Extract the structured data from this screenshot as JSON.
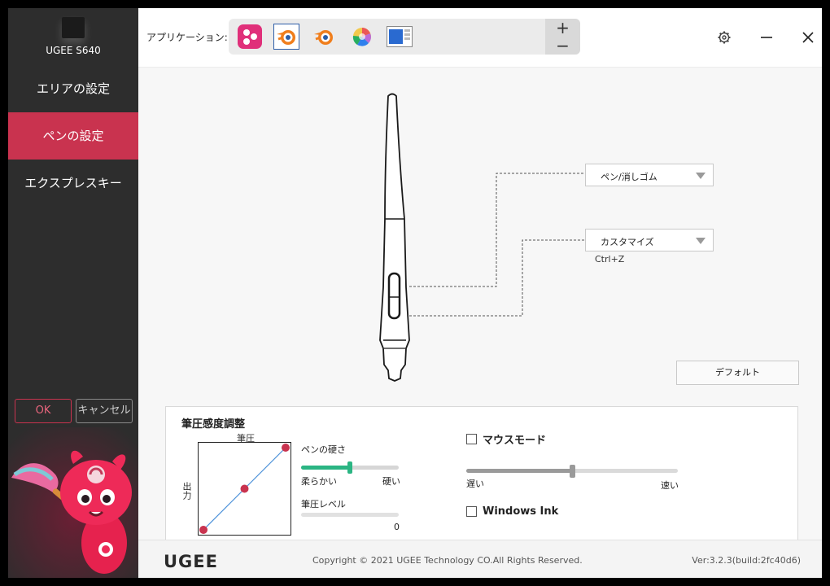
{
  "sidebar": {
    "device_name": "UGEE S640",
    "nav": [
      {
        "label": "エリアの設定"
      },
      {
        "label": "ペンの設定",
        "active": true
      },
      {
        "label": "エクスプレスキー"
      }
    ],
    "ok_label": "OK",
    "cancel_label": "キャンセル"
  },
  "header": {
    "app_label": "アプリケーション:",
    "apps": [
      {
        "icon": "app-launcher-icon",
        "color": "#e0307a"
      },
      {
        "icon": "blender-icon",
        "color": "#f07e1c",
        "selected": true
      },
      {
        "icon": "blender-icon",
        "color": "#f07e1c"
      },
      {
        "icon": "color-wheel-icon"
      },
      {
        "icon": "window-app-icon",
        "color": "#2a6ad0"
      }
    ],
    "plus": "+",
    "minus": "−",
    "settings_icon": "gear-icon",
    "minimize_icon": "minimize-icon",
    "close_icon": "close-icon"
  },
  "pen": {
    "upper_button": {
      "value": "ペン/消しゴム"
    },
    "lower_button": {
      "value": "カスタマイズ",
      "shortcut": "Ctrl+Z"
    },
    "default_label": "デフォルト"
  },
  "pressure": {
    "title": "筆圧感度調整",
    "graph_top_label": "筆圧",
    "graph_side_label": "出力",
    "curve_points": [
      [
        0,
        0
      ],
      [
        0.5,
        0.5
      ],
      [
        1,
        1
      ]
    ],
    "hardness_label": "ペンの硬さ",
    "hardness_value": 0.5,
    "soft_label": "柔らかい",
    "hard_label": "硬い",
    "level_label": "筆圧レベル",
    "level_value": "0",
    "mouse_mode_label": "マウスモード",
    "mouse_mode_checked": false,
    "speed_value": 0.5,
    "slow_label": "遅い",
    "fast_label": "速い",
    "windows_ink_label": "Windows Ink",
    "windows_ink_checked": false
  },
  "footer": {
    "logo": "UGEE",
    "copyright": "Copyright © 2021 UGEE Technology CO.All Rights Reserved.",
    "version": "Ver:3.2.3(build:2fc40d6)"
  },
  "colors": {
    "accent": "#c9334f",
    "slider_green": "#2bb583",
    "curve_line": "#4a90d9",
    "curve_point": "#c9334f",
    "sidebar_bg": "#2d2d2d"
  }
}
